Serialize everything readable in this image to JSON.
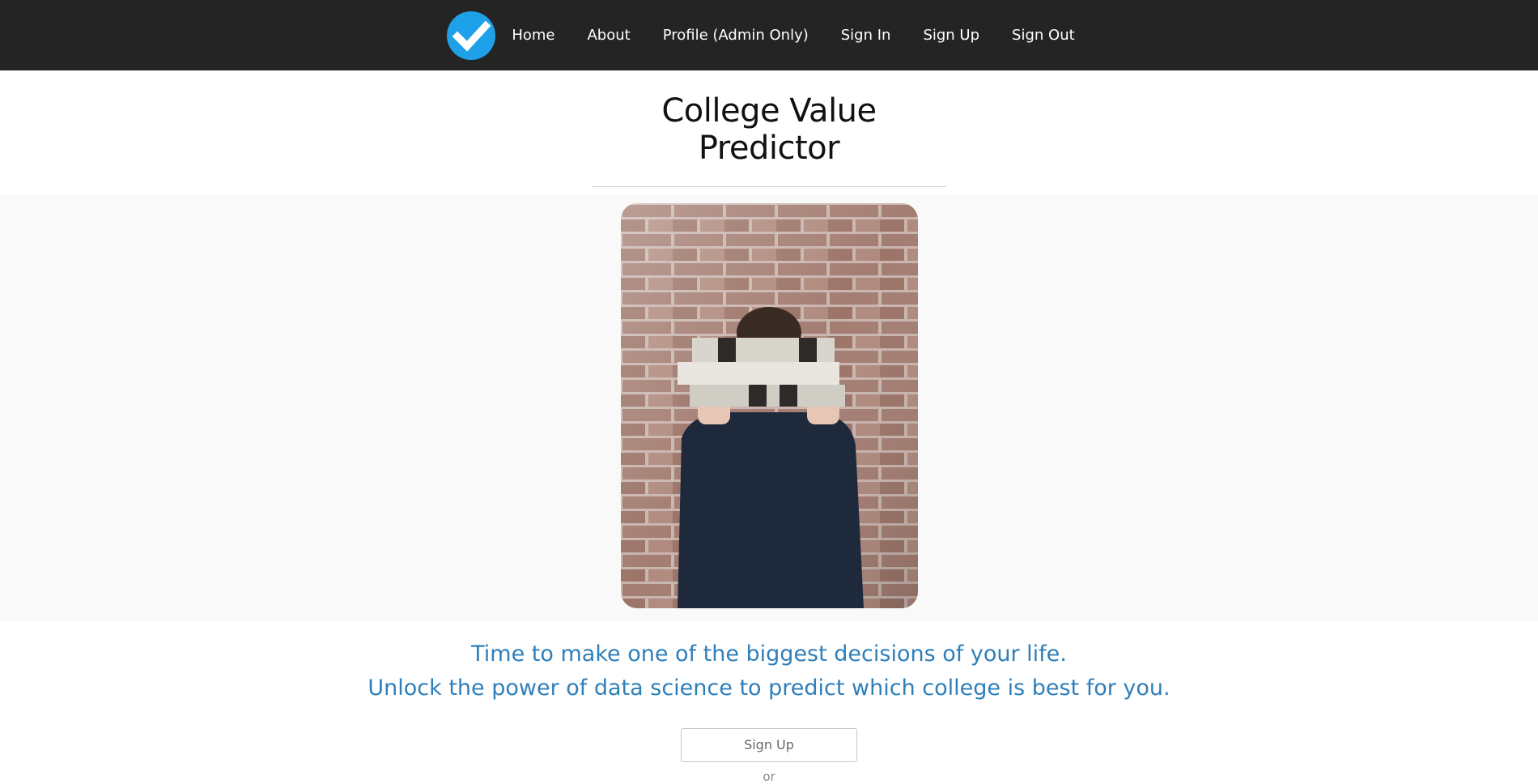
{
  "nav": {
    "logo_icon": "checkmark-circle-icon",
    "logo_color": "#1ea1e8",
    "items": [
      {
        "label": "Home"
      },
      {
        "label": "About"
      },
      {
        "label": "Profile (Admin Only)"
      },
      {
        "label": "Sign In"
      },
      {
        "label": "Sign Up"
      },
      {
        "label": "Sign Out"
      }
    ]
  },
  "page": {
    "title": "College Value Predictor"
  },
  "hero": {
    "image": "photo of person holding a stack of books in front of a brick wall"
  },
  "tagline": {
    "line1": "Time to make one of the biggest decisions of your life.",
    "line2": "Unlock the power of data science to predict which college is best for you."
  },
  "actions": {
    "signup_label": "Sign Up",
    "or_label": "or"
  },
  "colors": {
    "navbar_bg": "#242424",
    "accent": "#2f7fba",
    "hero_bg": "#f9f9f9"
  }
}
